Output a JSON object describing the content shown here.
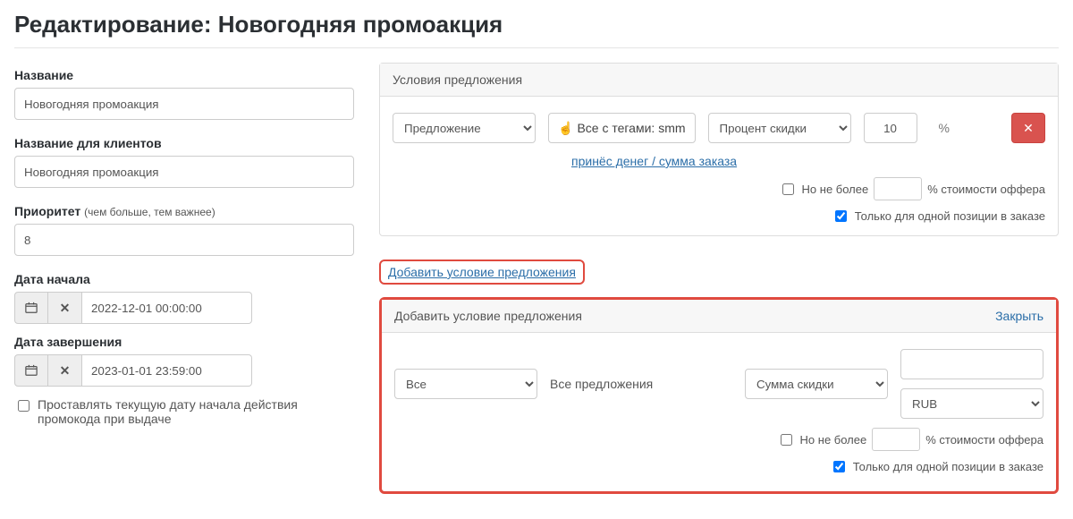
{
  "page_title": "Редактирование: Новогодняя промоакция",
  "left": {
    "name_label": "Название",
    "name_value": "Новогодняя промоакция",
    "client_name_label": "Название для клиентов",
    "client_name_value": "Новогодняя промоакция",
    "priority_label": "Приоритет",
    "priority_hint": "(чем больше, тем важнее)",
    "priority_value": "8",
    "date_start_label": "Дата начала",
    "date_start_value": "2022-12-01 00:00:00",
    "date_end_label": "Дата завершения",
    "date_end_value": "2023-01-01 23:59:00",
    "auto_date_label": "Проставлять текущую дату начала действия промокода при выдаче"
  },
  "cond_panel": {
    "header": "Условия предложения",
    "offer_select": "Предложение",
    "tag_button": "Все с тегами: smm",
    "discount_type_select": "Процент скидки",
    "discount_value": "10",
    "discount_unit": "%",
    "sub_link": "принёс денег / сумма заказа",
    "max_label_a": "Но не более",
    "max_label_b": "% стоимости оффера",
    "single_pos_label": "Только для одной позиции в заказе"
  },
  "add_link": "Добавить условие предложения",
  "add_panel": {
    "header": "Добавить условие предложения",
    "close": "Закрыть",
    "filter_select": "Все",
    "offers_text": "Все предложения",
    "discount_type_select": "Сумма скидки",
    "currency": "RUB",
    "max_label_a": "Но не более",
    "max_label_b": "% стоимости оффера",
    "single_pos_label": "Только для одной позиции в заказе"
  }
}
